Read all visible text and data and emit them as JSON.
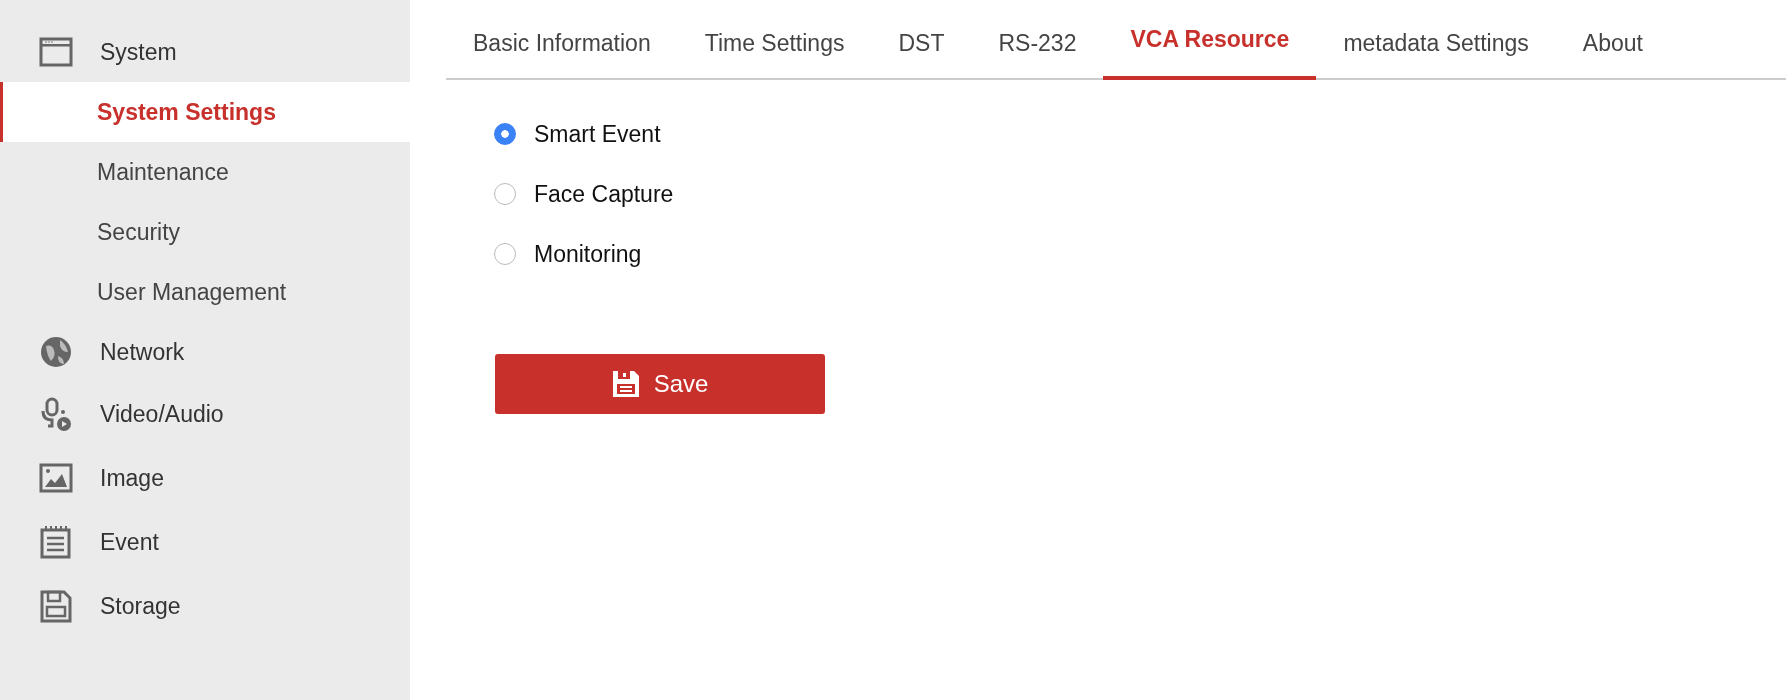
{
  "sidebar": {
    "sections": [
      {
        "label": "System",
        "children": [
          {
            "label": "System Settings",
            "selected": true
          },
          {
            "label": "Maintenance",
            "selected": false
          },
          {
            "label": "Security",
            "selected": false
          },
          {
            "label": "User Management",
            "selected": false
          }
        ]
      },
      {
        "label": "Network"
      },
      {
        "label": "Video/Audio"
      },
      {
        "label": "Image"
      },
      {
        "label": "Event"
      },
      {
        "label": "Storage"
      }
    ]
  },
  "tabs": [
    {
      "label": "Basic Information",
      "selected": false
    },
    {
      "label": "Time Settings",
      "selected": false
    },
    {
      "label": "DST",
      "selected": false
    },
    {
      "label": "RS-232",
      "selected": false
    },
    {
      "label": "VCA Resource",
      "selected": true
    },
    {
      "label": "metadata Settings",
      "selected": false
    },
    {
      "label": "About",
      "selected": false
    }
  ],
  "options": [
    {
      "label": "Smart Event",
      "selected": true
    },
    {
      "label": "Face Capture",
      "selected": false
    },
    {
      "label": "Monitoring",
      "selected": false
    }
  ],
  "save_button": {
    "label": "Save"
  }
}
